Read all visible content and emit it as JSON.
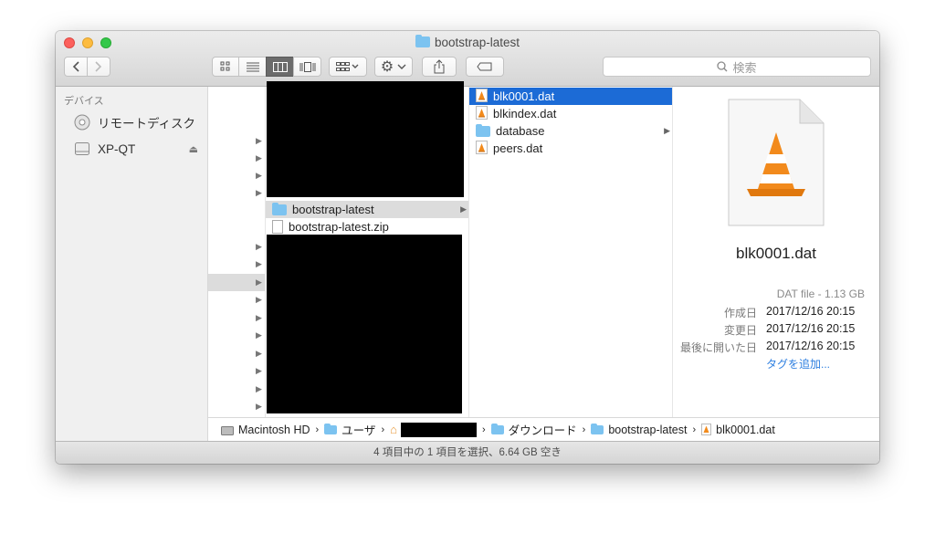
{
  "window": {
    "title": "bootstrap-latest",
    "search_placeholder": "検索"
  },
  "sidebar": {
    "section": "デバイス",
    "items": [
      {
        "label": "リモートディスク",
        "icon": "optical-disc-icon"
      },
      {
        "label": "XP-QT",
        "icon": "drive-icon"
      }
    ]
  },
  "column2": {
    "items": [
      {
        "label": "bootstrap-latest",
        "icon": "folder-icon",
        "selected": true
      },
      {
        "label": "bootstrap-latest.zip",
        "icon": "zip-file-icon",
        "selected": false
      }
    ]
  },
  "column3": {
    "items": [
      {
        "label": "blk0001.dat",
        "icon": "vlc-file-icon",
        "selected": true
      },
      {
        "label": "blkindex.dat",
        "icon": "vlc-file-icon",
        "selected": false
      },
      {
        "label": "database",
        "icon": "folder-icon",
        "selected": false
      },
      {
        "label": "peers.dat",
        "icon": "vlc-file-icon",
        "selected": false
      }
    ]
  },
  "preview": {
    "filename": "blk0001.dat",
    "kind_size": "DAT file - 1.13 GB",
    "created_label": "作成日",
    "created_value": "2017/12/16 20:15",
    "modified_label": "変更日",
    "modified_value": "2017/12/16 20:15",
    "opened_label": "最後に開いた日",
    "opened_value": "2017/12/16 20:15",
    "add_tags": "タグを追加..."
  },
  "pathbar": {
    "items": [
      {
        "label": "Macintosh HD",
        "icon": "hard-drive-icon"
      },
      {
        "label": "ユーザ",
        "icon": "users-folder-icon"
      },
      {
        "label": "",
        "icon": "home-icon"
      },
      {
        "label": "ダウンロード",
        "icon": "downloads-folder-icon"
      },
      {
        "label": "bootstrap-latest",
        "icon": "folder-icon"
      },
      {
        "label": "blk0001.dat",
        "icon": "vlc-file-icon"
      }
    ]
  },
  "status": "4 項目中の 1 項目を選択、6.64 GB 空き",
  "colors": {
    "selection": "#1c6bd6",
    "tag_link": "#2e7fe0",
    "folder": "#7cc3f0"
  }
}
